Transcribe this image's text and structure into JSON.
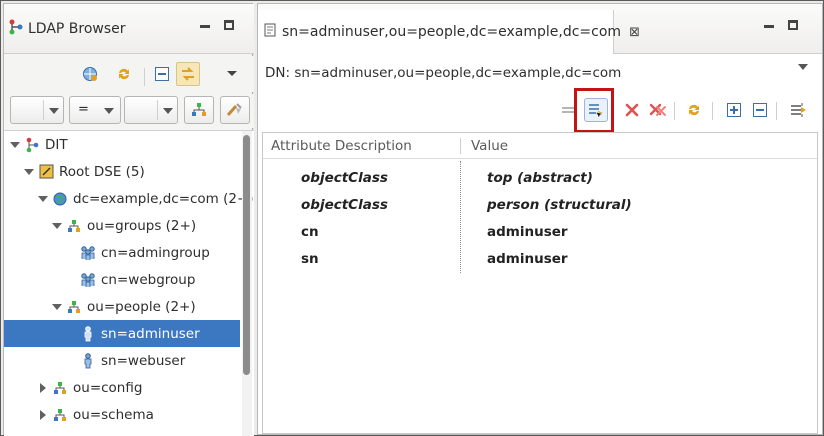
{
  "left_view": {
    "title": "LDAP Browser",
    "filter": {
      "attribute_value": "",
      "operator_value": "=",
      "value_value": ""
    },
    "tree": [
      {
        "label": "DIT",
        "level": 0,
        "expanded": true,
        "icon": "dit-icon"
      },
      {
        "label": "Root DSE (5)",
        "level": 1,
        "expanded": true,
        "icon": "root-dse-icon"
      },
      {
        "label": "dc=example,dc=com (2+)",
        "level": 2,
        "expanded": true,
        "icon": "globe-icon"
      },
      {
        "label": "ou=groups (2+)",
        "level": 3,
        "expanded": true,
        "icon": "org-unit-icon"
      },
      {
        "label": "cn=admingroup",
        "level": 4,
        "expanded": null,
        "icon": "group-icon"
      },
      {
        "label": "cn=webgroup",
        "level": 4,
        "expanded": null,
        "icon": "group-icon"
      },
      {
        "label": "ou=people (2+)",
        "level": 3,
        "expanded": true,
        "icon": "org-unit-icon"
      },
      {
        "label": "sn=adminuser",
        "level": 4,
        "expanded": null,
        "icon": "person-icon",
        "selected": true
      },
      {
        "label": "sn=webuser",
        "level": 4,
        "expanded": null,
        "icon": "person-icon"
      },
      {
        "label": "ou=config",
        "level": 2,
        "expanded": false,
        "icon": "org-unit-icon"
      },
      {
        "label": "ou=schema",
        "level": 2,
        "expanded": false,
        "icon": "org-unit-icon"
      }
    ]
  },
  "editor": {
    "tab_title": "sn=adminuser,ou=people,dc=example,dc=com",
    "dn_label": "DN: sn=adminuser,ou=people,dc=example,dc=com",
    "columns": {
      "attribute": "Attribute Description",
      "value": "Value"
    },
    "rows": [
      {
        "attribute": "objectClass",
        "value": "top (abstract)",
        "italic": true
      },
      {
        "attribute": "objectClass",
        "value": "person (structural)",
        "italic": true
      },
      {
        "attribute": "cn",
        "value": "adminuser",
        "italic": false
      },
      {
        "attribute": "sn",
        "value": "adminuser",
        "italic": false
      }
    ]
  },
  "colors": {
    "selection": "#3b78c1",
    "highlight_box": "#c21414",
    "delete_icon": "#e05252",
    "refresh_icon": "#e0a020"
  }
}
